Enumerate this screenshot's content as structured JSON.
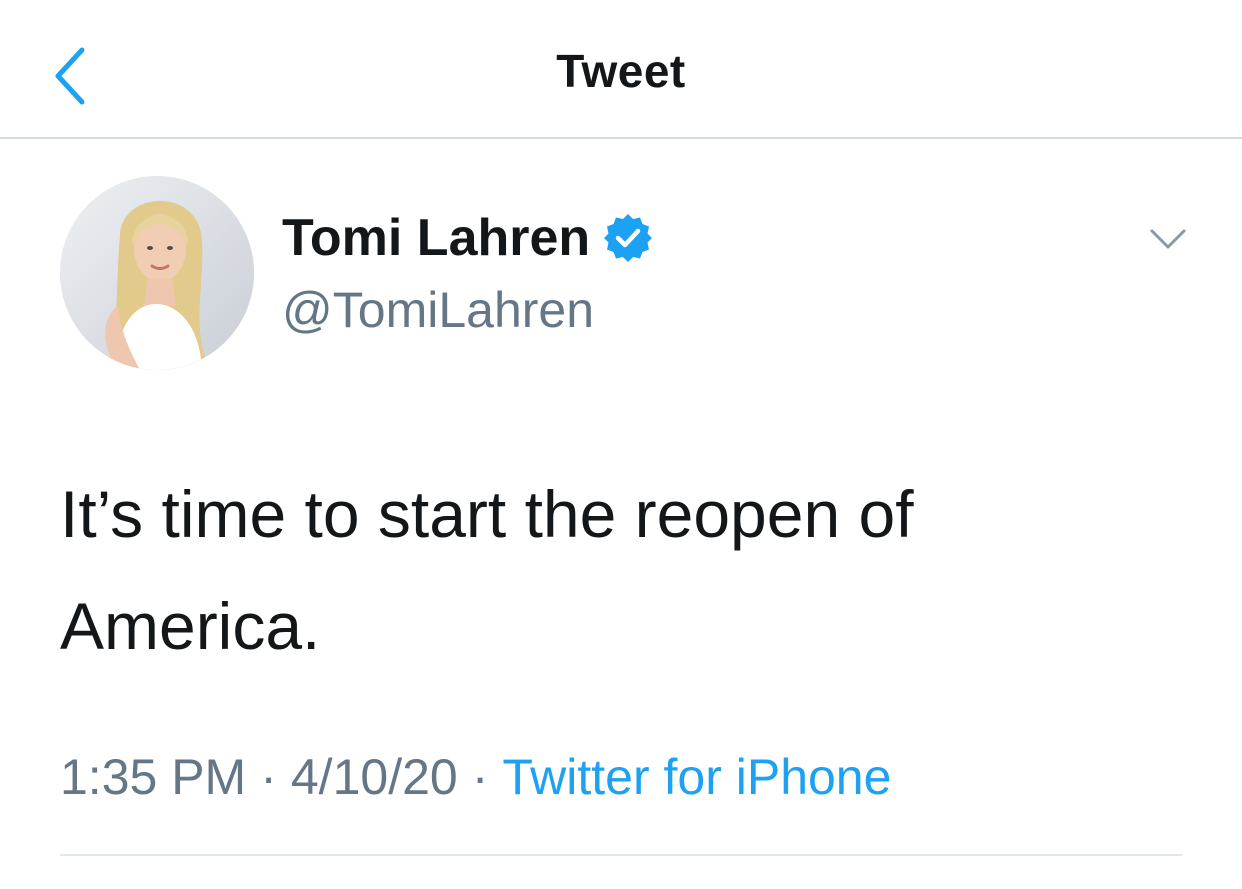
{
  "nav": {
    "title": "Tweet",
    "back_icon": "chevron-left-icon"
  },
  "tweet": {
    "author": {
      "display_name": "Tomi Lahren",
      "username": "@TomiLahren",
      "verified": true,
      "verified_icon": "verified-badge-icon"
    },
    "text": "It’s time to start the reopen of America.",
    "time": "1:35 PM",
    "date": "4/10/20",
    "separator": "·",
    "source": "Twitter for iPhone",
    "more_icon": "chevron-down-icon"
  },
  "colors": {
    "accent": "#1da1f2",
    "text_primary": "#14171a",
    "text_secondary": "#657786",
    "divider": "#e1e8ed"
  }
}
